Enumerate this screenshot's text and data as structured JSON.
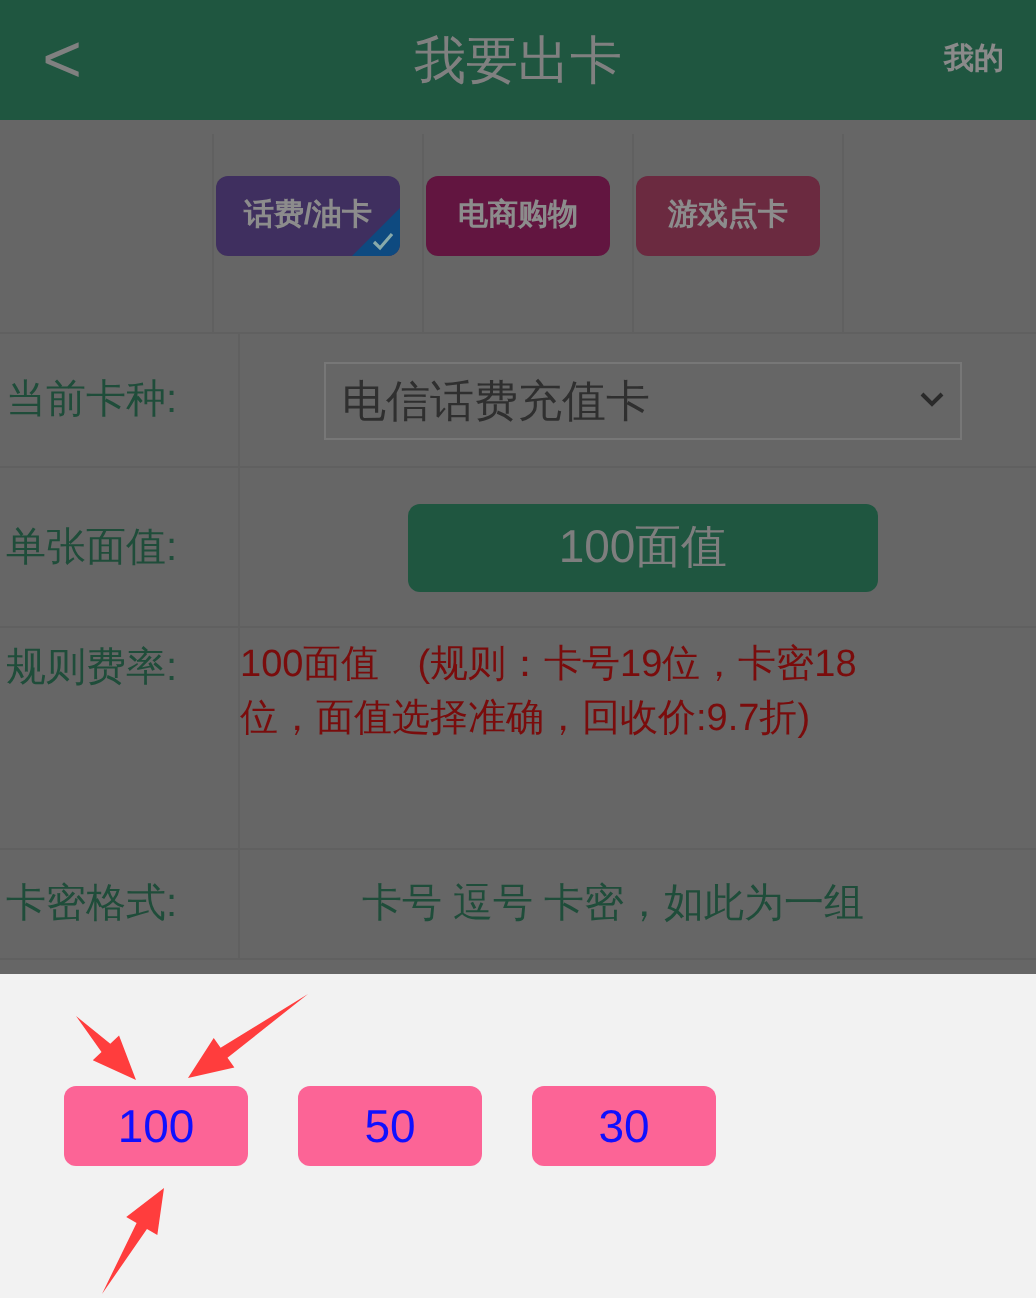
{
  "header": {
    "back": "<",
    "title": "我要出卡",
    "right": "我的"
  },
  "categories": [
    {
      "label": "话费/油卡",
      "selected": true,
      "color": "#3f2f5f"
    },
    {
      "label": "电商购物",
      "selected": false,
      "color": "#621540"
    },
    {
      "label": "游戏点卡",
      "selected": false,
      "color": "#6b2a40"
    }
  ],
  "form": [
    {
      "kind": "select",
      "label": "当前卡种:",
      "value": "电信话费充值卡"
    },
    {
      "kind": "button",
      "label": "单张面值:",
      "value": "100面值"
    },
    {
      "kind": "rule",
      "label": "规则费率:",
      "value": "100面值　(规则：卡号19位，卡密18位，面值选择准确，回收价:9.7折)"
    },
    {
      "kind": "text",
      "label": "卡密格式:",
      "value": "卡号 逗号 卡密，如此为一组"
    }
  ],
  "sheet": {
    "options": [
      "100",
      "50",
      "30"
    ]
  }
}
